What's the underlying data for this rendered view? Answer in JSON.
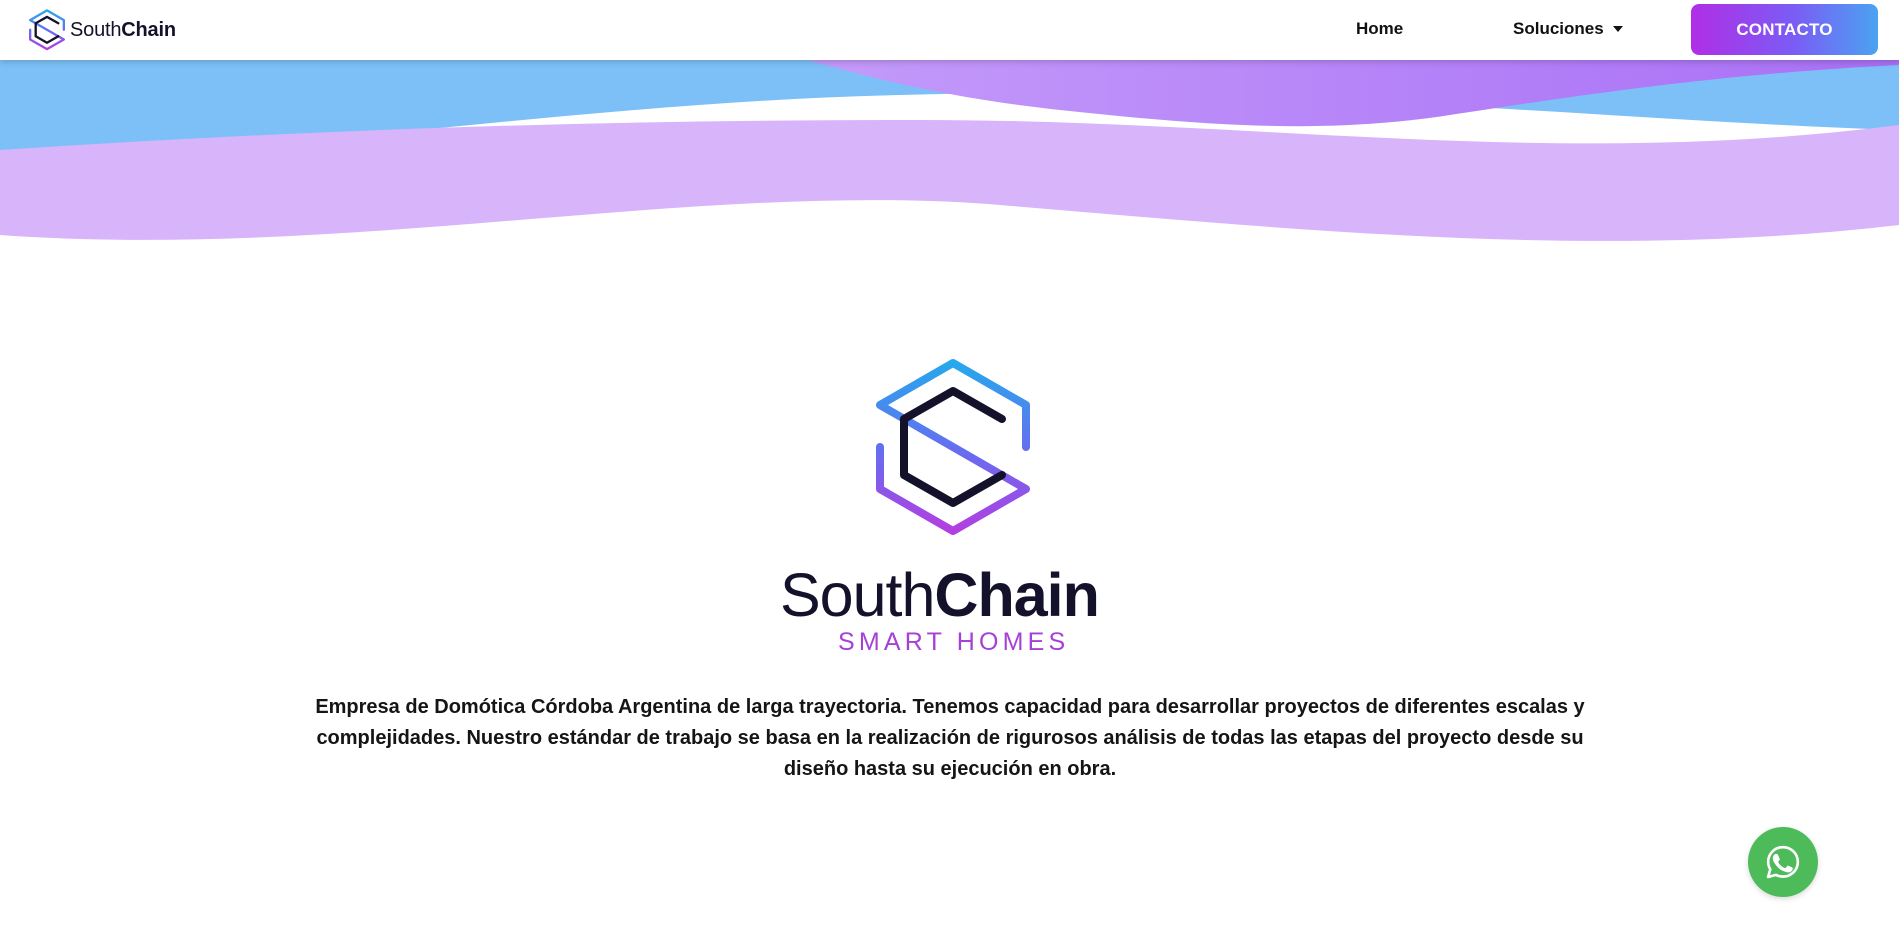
{
  "header": {
    "brand": {
      "name_thin": "South",
      "name_bold": "Chain",
      "logo_icon": "southchain-hexagon-s-icon"
    },
    "nav": {
      "home_label": "Home",
      "soluciones_label": "Soluciones",
      "dropdown_icon": "caret-down-icon"
    },
    "contact_label": "CONTACTO"
  },
  "hero": {
    "logo_icon": "southchain-hexagon-s-icon",
    "title_thin": "South",
    "title_bold": "Chain",
    "subtitle": "SMART HOMES",
    "description": "Empresa de Domótica Córdoba Argentina de larga trayectoria. Tenemos capacidad para desarrollar proyectos de diferentes escalas y complejidades. Nuestro estándar de trabajo se basa en la realización de rigurosos análisis de todas las etapas del proyecto desde su diseño hasta su ejecución en obra."
  },
  "floating": {
    "whatsapp_icon": "whatsapp-icon"
  },
  "colors": {
    "accent_purple": "#b12ee6",
    "accent_blue": "#4aa3f2",
    "wave_blue": "#7cc0f7",
    "wave_lavender": "#d8b4fb",
    "wave_violet": "#b47cf7",
    "whatsapp_green": "#4dbb5a",
    "text_dark": "#14122b"
  }
}
